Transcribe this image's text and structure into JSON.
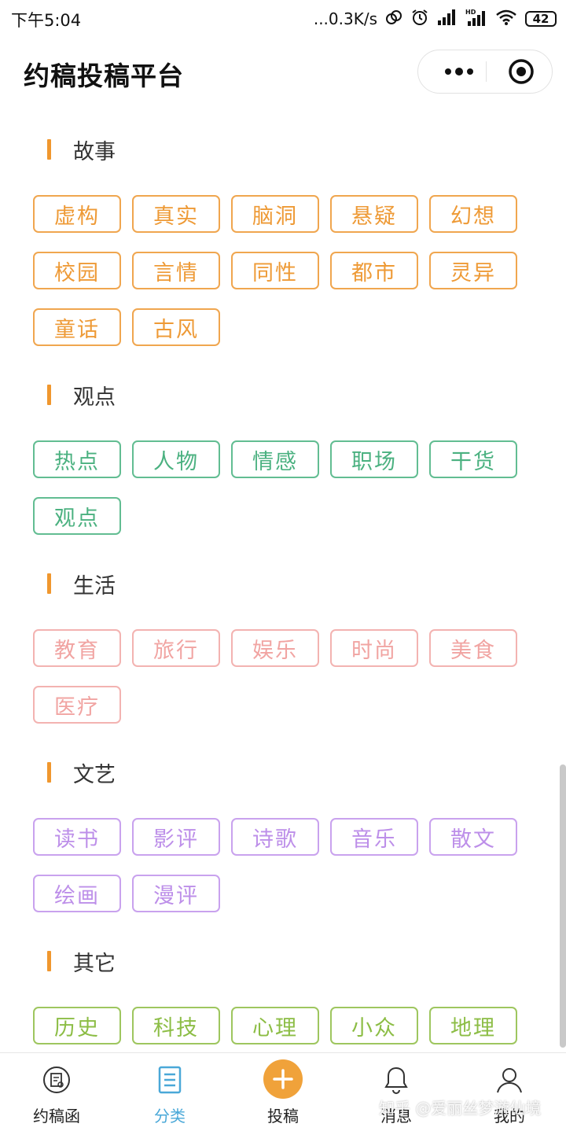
{
  "status_bar": {
    "time": "下午5:04",
    "network_speed": "...0.3K/s",
    "battery": "42",
    "icons": [
      "link-icon",
      "alarm-icon",
      "signal-icon",
      "hd-signal-icon",
      "wifi-icon",
      "battery-icon"
    ]
  },
  "header": {
    "title": "约稿投稿平台",
    "more_icon": "more-dots-icon",
    "close_icon": "target-close-icon"
  },
  "sections": [
    {
      "title": "故事",
      "color": "#ee9a36",
      "tags": [
        "虚构",
        "真实",
        "脑洞",
        "悬疑",
        "幻想",
        "校园",
        "言情",
        "同性",
        "都市",
        "灵异",
        "童话",
        "古风"
      ]
    },
    {
      "title": "观点",
      "color": "#4bb180",
      "tags": [
        "热点",
        "人物",
        "情感",
        "职场",
        "干货",
        "观点"
      ]
    },
    {
      "title": "生活",
      "color": "#f1a4a2",
      "tags": [
        "教育",
        "旅行",
        "娱乐",
        "时尚",
        "美食",
        "医疗"
      ]
    },
    {
      "title": "文艺",
      "color": "#bd8fe9",
      "tags": [
        "读书",
        "影评",
        "诗歌",
        "音乐",
        "散文",
        "绘画",
        "漫评"
      ]
    },
    {
      "title": "其它",
      "color": "#8cbd45",
      "tags": [
        "历史",
        "科技",
        "心理",
        "小众",
        "地理"
      ]
    }
  ],
  "tab_bar": {
    "tabs": [
      {
        "label": "约稿函",
        "icon": "invitation-icon",
        "active": false
      },
      {
        "label": "分类",
        "icon": "category-list-icon",
        "active": true
      },
      {
        "label": "投稿",
        "icon": "plus-icon",
        "active": false
      },
      {
        "label": "消息",
        "icon": "bell-icon",
        "active": false
      },
      {
        "label": "我的",
        "icon": "user-icon",
        "active": false
      }
    ],
    "active_color": "#4aa8d8",
    "post_color": "#f0a23a"
  },
  "watermark": "知乎 @爱丽丝梦游仙境"
}
